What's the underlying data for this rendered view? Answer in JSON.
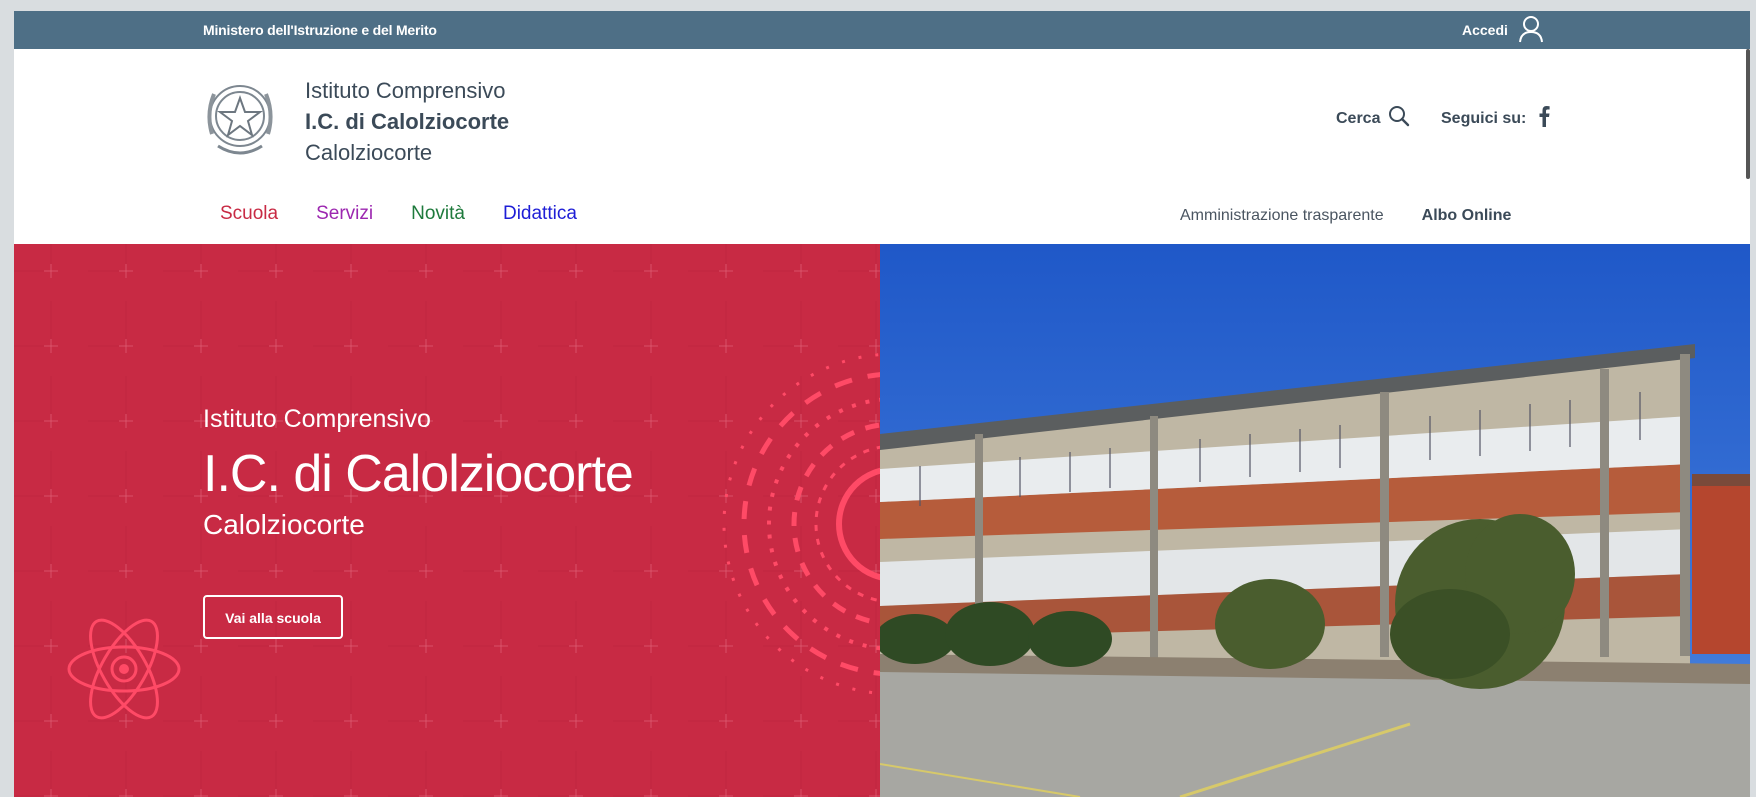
{
  "topbar": {
    "ministry": "Ministero dell'Istruzione e del Merito",
    "login_label": "Accedi",
    "login_icon": "user-icon",
    "bg_color": "#4e6f86"
  },
  "header": {
    "emblem_icon": "republic-emblem-icon",
    "brand": {
      "type": "Istituto Comprensivo",
      "name": "I.C. di Calolziocorte",
      "city": "Calolziocorte"
    },
    "search_label": "Cerca",
    "search_icon": "search-icon",
    "social_label": "Seguici su:",
    "social_icon": "facebook-icon"
  },
  "main_nav": [
    {
      "label": "Scuola",
      "color": "#c82a44"
    },
    {
      "label": "Servizi",
      "color": "#9c27b0"
    },
    {
      "label": "Novità",
      "color": "#1e7a3c"
    },
    {
      "label": "Didattica",
      "color": "#1e1ed6"
    }
  ],
  "secondary_nav": [
    {
      "label": "Amministrazione trasparente"
    },
    {
      "label": "Albo Online"
    }
  ],
  "hero": {
    "subtitle": "Istituto Comprensivo",
    "title": "I.C. di Calolziocorte",
    "location": "Calolziocorte",
    "button_label": "Vai alla scuola",
    "bg_color": "#c82a44"
  }
}
